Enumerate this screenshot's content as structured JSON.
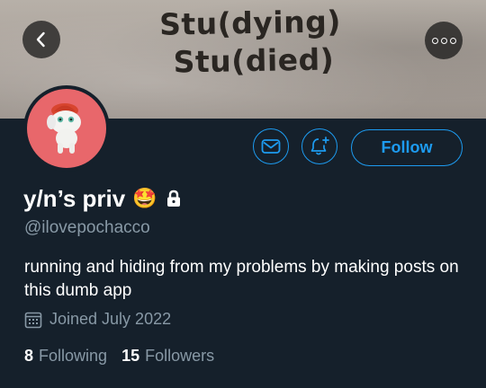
{
  "banner": {
    "line1": "Stu(dying)",
    "line2": "Stu(died)"
  },
  "header": {
    "back_icon": "chevron-left-icon",
    "more_icon": "more-dots-icon"
  },
  "actions": {
    "message_icon": "mail-icon",
    "notify_icon": "bell-plus-icon",
    "follow_label": "Follow"
  },
  "profile": {
    "display_name": "y/n’s priv",
    "name_emoji": "🤩",
    "protected_icon": "lock-icon",
    "handle": "@ilovepochacco",
    "bio": "running and hiding from my problems by making posts on this dumb app",
    "joined": "Joined July 2022",
    "following_count": "8",
    "following_label": "Following",
    "followers_count": "15",
    "followers_label": "Followers"
  },
  "colors": {
    "background": "#15202b",
    "accent": "#1d9bf0",
    "secondary_text": "#8899a6",
    "avatar_bg": "#e8676b"
  }
}
